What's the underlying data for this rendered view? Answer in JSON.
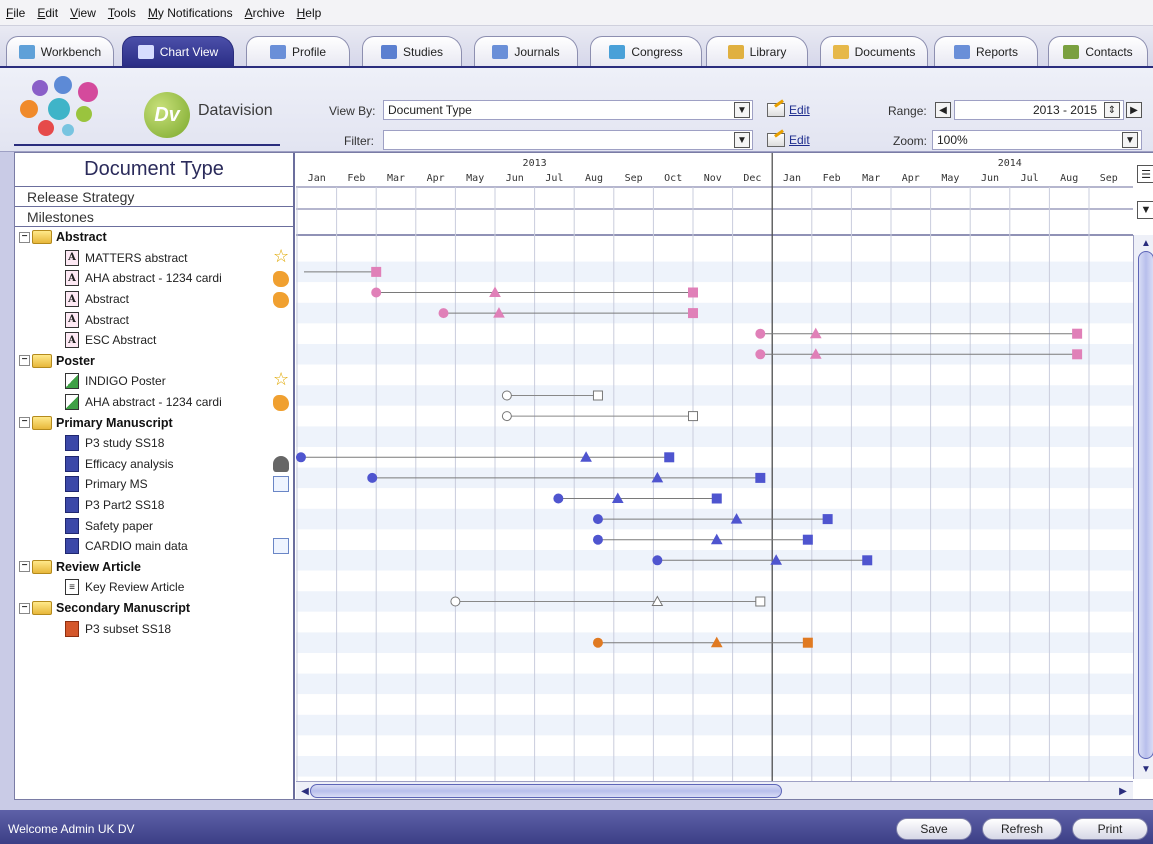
{
  "menu": [
    "File",
    "Edit",
    "View",
    "Tools",
    "My Notifications",
    "Archive",
    "Help"
  ],
  "tabs": [
    {
      "label": "Workbench",
      "icon": "workbench-icon",
      "active": false
    },
    {
      "label": "Chart View",
      "icon": "chart-view-icon",
      "active": true
    },
    {
      "label": "Profile",
      "icon": "profile-icon",
      "active": false
    },
    {
      "label": "Studies",
      "icon": "studies-icon",
      "active": false
    },
    {
      "label": "Journals",
      "icon": "journals-icon",
      "active": false
    },
    {
      "label": "Congress",
      "icon": "congress-icon",
      "active": false
    },
    {
      "label": "Library",
      "icon": "library-icon",
      "active": false
    },
    {
      "label": "Documents",
      "icon": "documents-icon",
      "active": false
    },
    {
      "label": "Reports",
      "icon": "reports-icon",
      "active": false
    },
    {
      "label": "Contacts",
      "icon": "contacts-icon",
      "active": false
    }
  ],
  "header": {
    "brand": "Datavision",
    "brand_initials": "Dv",
    "view_by_label": "View By:",
    "view_by_value": "Document Type",
    "filter_label": "Filter:",
    "filter_value": "",
    "edit_label": "Edit",
    "range_label": "Range:",
    "range_value": "2013 - 2015",
    "zoom_label": "Zoom:",
    "zoom_value": "100%"
  },
  "left": {
    "title": "Document Type",
    "release_strategy": "Release Strategy",
    "milestones": "Milestones"
  },
  "timeline": {
    "years": [
      "2013",
      "2014"
    ],
    "months": [
      "Jan",
      "Feb",
      "Mar",
      "Apr",
      "May",
      "Jun",
      "Jul",
      "Aug",
      "Sep",
      "Oct",
      "Nov",
      "Dec",
      "Jan",
      "Feb",
      "Mar",
      "Apr",
      "May",
      "Jun",
      "Jul",
      "Aug",
      "Sep"
    ]
  },
  "tree": [
    {
      "type": "group",
      "label": "Abstract"
    },
    {
      "type": "doc",
      "label": "MATTERS abstract",
      "kind": "abs",
      "right_icon": "star-icon",
      "color": "#e080b8",
      "start": null,
      "mid": null,
      "end": 2.0,
      "hollow": false
    },
    {
      "type": "doc",
      "label": "AHA abstract - 1234 cardi",
      "kind": "abs",
      "right_icon": "hand-icon",
      "color": "#e080b8",
      "start": 2.0,
      "mid": 5.0,
      "end": 10.0,
      "hollow": false
    },
    {
      "type": "doc",
      "label": "Abstract",
      "kind": "abs",
      "right_icon": "hand-icon",
      "color": "#e080b8",
      "start": 3.7,
      "mid": 5.1,
      "end": 10.0,
      "hollow": false
    },
    {
      "type": "doc",
      "label": "Abstract",
      "kind": "abs",
      "right_icon": "",
      "color": "#e080b8",
      "start": 11.7,
      "mid": 13.1,
      "end": 19.7,
      "hollow": false
    },
    {
      "type": "doc",
      "label": "ESC Abstract",
      "kind": "abs",
      "right_icon": "",
      "color": "#e080b8",
      "start": 11.7,
      "mid": 13.1,
      "end": 19.7,
      "hollow": false
    },
    {
      "type": "group",
      "label": "Poster"
    },
    {
      "type": "doc",
      "label": "INDIGO Poster",
      "kind": "poster",
      "right_icon": "star-icon",
      "color": "#777777",
      "start": 5.3,
      "mid": null,
      "end": 7.6,
      "hollow": true
    },
    {
      "type": "doc",
      "label": "AHA abstract - 1234 cardi",
      "kind": "poster",
      "right_icon": "hand-icon",
      "color": "#777777",
      "start": 5.3,
      "mid": null,
      "end": 10.0,
      "hollow": true
    },
    {
      "type": "group",
      "label": "Primary Manuscript"
    },
    {
      "type": "doc",
      "label": "P3 study SS18",
      "kind": "ms",
      "right_icon": "",
      "color": "#4f55cf",
      "start": 0.1,
      "mid": 7.3,
      "end": 9.4,
      "hollow": false
    },
    {
      "type": "doc",
      "label": "Efficacy analysis",
      "kind": "ms",
      "right_icon": "trophy-icon",
      "color": "#4f55cf",
      "start": 1.9,
      "mid": 9.1,
      "end": 11.7,
      "hollow": false
    },
    {
      "type": "doc",
      "label": "Primary MS",
      "kind": "ms",
      "right_icon": "doc-search-icon",
      "color": "#4f55cf",
      "start": 6.6,
      "mid": 8.1,
      "end": 10.6,
      "hollow": false
    },
    {
      "type": "doc",
      "label": "P3 Part2 SS18",
      "kind": "ms",
      "right_icon": "",
      "color": "#4f55cf",
      "start": 7.6,
      "mid": 11.1,
      "end": 13.4,
      "hollow": false
    },
    {
      "type": "doc",
      "label": "Safety paper",
      "kind": "ms",
      "right_icon": "",
      "color": "#4f55cf",
      "start": 7.6,
      "mid": 10.6,
      "end": 12.9,
      "hollow": false
    },
    {
      "type": "doc",
      "label": "CARDIO main data",
      "kind": "ms",
      "right_icon": "doc-search-icon",
      "color": "#4f55cf",
      "start": 9.1,
      "mid": 12.1,
      "end": 14.4,
      "hollow": false
    },
    {
      "type": "group",
      "label": "Review Article"
    },
    {
      "type": "doc",
      "label": "Key Review Article",
      "kind": "review",
      "right_icon": "",
      "color": "#777777",
      "start": 4.0,
      "mid": 9.1,
      "end": 11.7,
      "hollow": true
    },
    {
      "type": "group",
      "label": "Secondary Manuscript"
    },
    {
      "type": "doc",
      "label": "P3 subset SS18",
      "kind": "sec",
      "right_icon": "",
      "color": "#e07a22",
      "start": 7.6,
      "mid": 10.6,
      "end": 12.9,
      "hollow": false
    }
  ],
  "status": {
    "welcome": "Welcome Admin UK DV",
    "save": "Save",
    "refresh": "Refresh",
    "print": "Print"
  }
}
